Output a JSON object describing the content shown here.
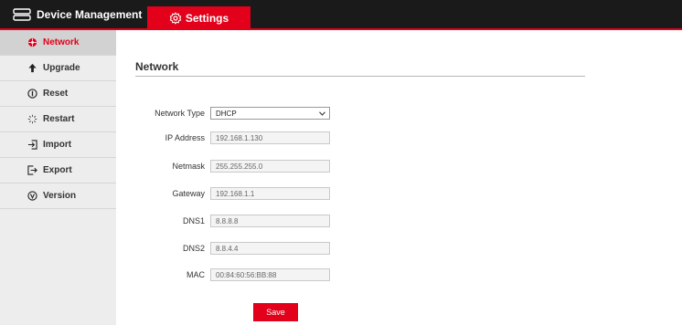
{
  "header": {
    "brand_label": "Device Management",
    "settings_tab_label": "Settings",
    "accent_color": "#e2001a",
    "bar_color": "#1a1a1a"
  },
  "sidebar": {
    "items": [
      {
        "label": "Network",
        "icon": "network-icon",
        "active": true
      },
      {
        "label": "Upgrade",
        "icon": "upgrade-arrow-icon",
        "active": false
      },
      {
        "label": "Reset",
        "icon": "reset-icon",
        "active": false
      },
      {
        "label": "Restart",
        "icon": "restart-icon",
        "active": false
      },
      {
        "label": "Import",
        "icon": "import-icon",
        "active": false
      },
      {
        "label": "Export",
        "icon": "export-icon",
        "active": false
      },
      {
        "label": "Version",
        "icon": "version-icon",
        "active": false
      }
    ]
  },
  "main": {
    "section_title": "Network",
    "fields": {
      "network_type": {
        "label": "Network Type",
        "value": "DHCP"
      },
      "ip_address": {
        "label": "IP Address",
        "value": "192.168.1.130"
      },
      "netmask": {
        "label": "Netmask",
        "value": "255.255.255.0"
      },
      "gateway": {
        "label": "Gateway",
        "value": "192.168.1.1"
      },
      "dns1": {
        "label": "DNS1",
        "value": "8.8.8.8"
      },
      "dns2": {
        "label": "DNS2",
        "value": "8.8.4.4"
      },
      "mac": {
        "label": "MAC",
        "value": "00:84:60:56:BB:88"
      }
    },
    "save_label": "Save"
  }
}
